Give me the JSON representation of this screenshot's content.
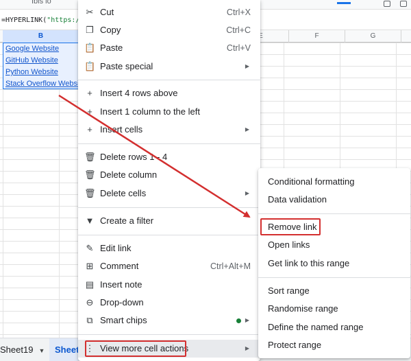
{
  "toolbar": {
    "ghost_text": "Ibis io"
  },
  "formula_bar": {
    "prefix": "=HYPERLINK(",
    "string": "\"https:/"
  },
  "columns": {
    "b": "B",
    "e": "E",
    "f": "F",
    "g": "G"
  },
  "cells": [
    "Google Website",
    "GitHub Website",
    "Python Website",
    "Stack Overflow Website"
  ],
  "sheets": {
    "sheet19": "Sheet19",
    "active_partial": "Sheet"
  },
  "context_menu": {
    "cut": {
      "label": "Cut",
      "shortcut": "Ctrl+X"
    },
    "copy": {
      "label": "Copy",
      "shortcut": "Ctrl+C"
    },
    "paste": {
      "label": "Paste",
      "shortcut": "Ctrl+V"
    },
    "paste_special": {
      "label": "Paste special"
    },
    "insert_rows": {
      "label": "Insert 4 rows above"
    },
    "insert_column": {
      "label": "Insert 1 column to the left"
    },
    "insert_cells": {
      "label": "Insert cells"
    },
    "delete_rows": {
      "label": "Delete rows 1 - 4"
    },
    "delete_column": {
      "label": "Delete column"
    },
    "delete_cells": {
      "label": "Delete cells"
    },
    "create_filter": {
      "label": "Create a filter"
    },
    "edit_link": {
      "label": "Edit link"
    },
    "comment": {
      "label": "Comment",
      "shortcut": "Ctrl+Alt+M"
    },
    "insert_note": {
      "label": "Insert note"
    },
    "drop_down": {
      "label": "Drop-down"
    },
    "smart_chips": {
      "label": "Smart chips"
    },
    "view_more": {
      "label": "View more cell actions"
    }
  },
  "submenu": {
    "conditional_formatting": "Conditional formatting",
    "data_validation": "Data validation",
    "remove_link": "Remove link",
    "open_links": "Open links",
    "get_link": "Get link to this range",
    "sort_range": "Sort range",
    "randomise_range": "Randomise range",
    "define_named_range": "Define the named range",
    "protect_range": "Protect range"
  },
  "colors": {
    "annotation_red": "#d32f2f",
    "link_blue": "#1155cc",
    "selection_blue": "#1a73e8",
    "smart_chip_dot": "#188038"
  }
}
